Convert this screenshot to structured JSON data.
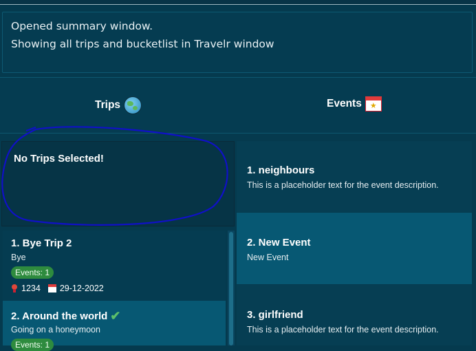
{
  "result": {
    "line1": "Opened summary window.",
    "line2": "Showing all trips and bucketlist in Travelr window"
  },
  "columns": {
    "trips_label": "Trips",
    "trips_icon": "globe-icon",
    "events_label": "Events",
    "events_icon": "calendar-star-icon"
  },
  "selected_trip": {
    "message": "No Trips Selected!"
  },
  "trips": [
    {
      "title": "1.  Bye Trip 2",
      "description": "Bye",
      "events_badge": "Events: 1",
      "location": "1234",
      "date": "29-12-2022",
      "completed": false
    },
    {
      "title": "2.  Around the world",
      "description": "Going on a honeymoon",
      "events_badge": "Events: 1",
      "completed": true
    }
  ],
  "events": [
    {
      "title": "1.  neighbours",
      "description": "This is a placeholder text for the event description."
    },
    {
      "title": "2.  New Event",
      "description": "New Event"
    },
    {
      "title": "3.  girlfriend",
      "description": "This is a placeholder text for the event description."
    }
  ],
  "colors": {
    "background": "#053a4e",
    "card": "#053c51",
    "card_alt": "#075873",
    "badge": "#2e8b3e",
    "annotation": "#1010c8"
  }
}
